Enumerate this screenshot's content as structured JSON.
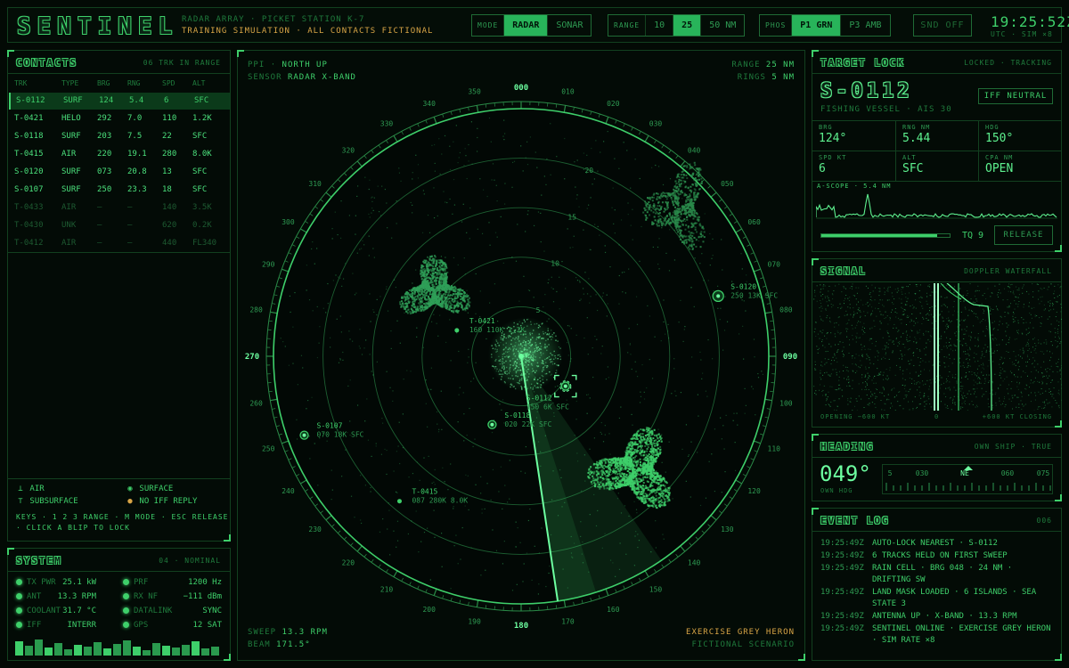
{
  "header": {
    "logo": "SENTINEL",
    "subtitle1": "RADAR ARRAY · PICKET STATION K-7",
    "subtitle2": "TRAINING SIMULATION · ALL CONTACTS FICTIONAL",
    "mode": {
      "label": "MODE",
      "options": [
        "RADAR",
        "SONAR"
      ],
      "selected": "RADAR"
    },
    "range": {
      "label": "RANGE",
      "options": [
        "10",
        "25",
        "50 NM"
      ],
      "selected": "25"
    },
    "phos": {
      "label": "PHOS",
      "options": [
        "P1 GRN",
        "P3 AMB"
      ],
      "selected": "P1 GRN"
    },
    "sound": "SND OFF",
    "clock": "19:25:52Z",
    "clock_sub": "UTC · SIM ×8"
  },
  "contacts": {
    "title": "CONTACTS",
    "count": "06 TRK IN RANGE",
    "columns": [
      "TRK",
      "TYPE",
      "BRG",
      "RNG",
      "SPD",
      "ALT"
    ],
    "rows": [
      {
        "trk": "S-0112",
        "type": "SURF",
        "brg": "124",
        "rng": "5.4",
        "spd": "6",
        "alt": "SFC",
        "state": "sel"
      },
      {
        "trk": "T-0421",
        "type": "HELO",
        "brg": "292",
        "rng": "7.0",
        "spd": "110",
        "alt": "1.2K",
        "state": "live"
      },
      {
        "trk": "S-0118",
        "type": "SURF",
        "brg": "203",
        "rng": "7.5",
        "spd": "22",
        "alt": "SFC",
        "state": "live"
      },
      {
        "trk": "T-0415",
        "type": "AIR",
        "brg": "220",
        "rng": "19.1",
        "spd": "280",
        "alt": "8.0K",
        "state": "live"
      },
      {
        "trk": "S-0120",
        "type": "SURF",
        "brg": "073",
        "rng": "20.8",
        "spd": "13",
        "alt": "SFC",
        "state": "live"
      },
      {
        "trk": "S-0107",
        "type": "SURF",
        "brg": "250",
        "rng": "23.3",
        "spd": "18",
        "alt": "SFC",
        "state": "live"
      },
      {
        "trk": "T-0433",
        "type": "AIR",
        "brg": "—",
        "rng": "—",
        "spd": "140",
        "alt": "3.5K",
        "state": "stale"
      },
      {
        "trk": "T-0430",
        "type": "UNK",
        "brg": "—",
        "rng": "—",
        "spd": "620",
        "alt": "0.2K",
        "state": "stale"
      },
      {
        "trk": "T-0412",
        "type": "AIR",
        "brg": "—",
        "rng": "—",
        "spd": "440",
        "alt": "FL340",
        "state": "stale"
      }
    ],
    "legend": {
      "air": "AIR",
      "surface": "SURFACE",
      "subsurface": "SUBSURFACE",
      "noiff": "NO IFF REPLY",
      "keys1": "KEYS · 1 2 3 RANGE · M MODE · ESC RELEASE",
      "keys2": "· CLICK A BLIP TO LOCK"
    }
  },
  "system": {
    "title": "SYSTEM",
    "status": "04 · NOMINAL",
    "left": [
      {
        "label": "TX PWR",
        "value": "25.1 kW"
      },
      {
        "label": "ANT",
        "value": "13.3 RPM"
      },
      {
        "label": "COOLANT",
        "value": "31.7 °C"
      },
      {
        "label": "IFF",
        "value": "INTERR"
      }
    ],
    "right": [
      {
        "label": "PRF",
        "value": "1200 Hz"
      },
      {
        "label": "RX NF",
        "value": "−111 dBm"
      },
      {
        "label": "DATALINK",
        "value": "SYNC"
      },
      {
        "label": "GPS",
        "value": "12 SAT"
      }
    ],
    "bars": [
      0.8,
      0.55,
      0.9,
      0.45,
      0.7,
      0.35,
      0.6,
      0.5,
      0.75,
      0.4,
      0.65,
      0.85,
      0.5,
      0.3,
      0.7,
      0.55,
      0.45,
      0.6,
      0.8,
      0.4,
      0.5
    ]
  },
  "radar": {
    "ppi_label": "PPI",
    "orientation": "NORTH UP",
    "sensor_label": "SENSOR",
    "sensor": "RADAR X-BAND",
    "range_label": "RANGE",
    "range_value": "25 NM",
    "rings_label": "RINGS",
    "rings_value": "5 NM",
    "ring_labels": [
      "5",
      "10",
      "15",
      "20"
    ],
    "bearings": [
      "000",
      "010",
      "020",
      "030",
      "040",
      "050",
      "060",
      "070",
      "080",
      "090",
      "100",
      "110",
      "120",
      "130",
      "140",
      "150",
      "160",
      "170",
      "180",
      "190",
      "200",
      "210",
      "220",
      "230",
      "240",
      "250",
      "260",
      "270",
      "280",
      "290",
      "300",
      "310",
      "320",
      "330",
      "340",
      "350"
    ],
    "sweep_label": "SWEEP",
    "sweep_value": "13.3 RPM",
    "beam_label": "BEAM",
    "beam_value": "171.5°",
    "exercise": "EXERCISE GREY HERON",
    "scenario": "FICTIONAL SCENARIO",
    "beam_deg": 171.5,
    "contacts": [
      {
        "id": "S-0112",
        "brg": 124,
        "rng": 5.4,
        "line2": "150 6K SFC",
        "locked": true
      },
      {
        "id": "T-0421",
        "brg": 292,
        "rng": 7.0,
        "line2": "160 110K 1.2K"
      },
      {
        "id": "S-0118",
        "brg": 203,
        "rng": 7.5,
        "line2": "020 22K SFC"
      },
      {
        "id": "T-0415",
        "brg": 220,
        "rng": 19.1,
        "line2": "087 280K 8.0K"
      },
      {
        "id": "S-0120",
        "brg": 73,
        "rng": 20.8,
        "line2": "250 13K SFC"
      },
      {
        "id": "S-0107",
        "brg": 250,
        "rng": 23.3,
        "line2": "070 18K SFC"
      }
    ]
  },
  "target": {
    "title": "TARGET LOCK",
    "status": "LOCKED · TRACKING",
    "id": "S-0112",
    "desc": "FISHING VESSEL · AIS 30",
    "iff": "IFF NEUTRAL",
    "cells": [
      {
        "label": "BRG",
        "value": "124°"
      },
      {
        "label": "RNG NM",
        "value": "5.44"
      },
      {
        "label": "HDG",
        "value": "150°"
      },
      {
        "label": "SPD KT",
        "value": "6"
      },
      {
        "label": "ALT",
        "value": "SFC"
      },
      {
        "label": "CPA NM",
        "value": "OPEN"
      }
    ],
    "ascope": "A-SCOPE · 5.4 NM",
    "tq": "TQ 9",
    "tq_fill": 0.9,
    "release": "RELEASE"
  },
  "signal": {
    "title": "SIGNAL",
    "mode": "DOPPLER WATERFALL",
    "left": "OPENING −600 KT",
    "center": "0",
    "right": "+600 KT CLOSING"
  },
  "heading": {
    "title": "HEADING",
    "mode": "OWN SHIP · TRUE",
    "value": "049°",
    "label": "OWN HDG",
    "ticks": [
      "5",
      "030",
      "NE",
      "060",
      "075"
    ]
  },
  "events": {
    "title": "EVENT LOG",
    "count": "006",
    "items": [
      {
        "t": "19:25:49Z",
        "m": "AUTO-LOCK NEAREST · S-0112"
      },
      {
        "t": "19:25:49Z",
        "m": "6 TRACKS HELD ON FIRST SWEEP"
      },
      {
        "t": "19:25:49Z",
        "m": "RAIN CELL · BRG 048 · 24 NM · DRIFTING SW"
      },
      {
        "t": "19:25:49Z",
        "m": "LAND MASK LOADED · 6 ISLANDS · SEA STATE 3"
      },
      {
        "t": "19:25:49Z",
        "m": "ANTENNA UP · X-BAND · 13.3 RPM"
      },
      {
        "t": "19:25:49Z",
        "m": "SENTINEL ONLINE · EXERCISE GREY HERON · SIM RATE ×8"
      }
    ]
  },
  "colors": {
    "phosphor": "#3ecf6a",
    "bright": "#6dffa0",
    "dim": "#1f7a3c",
    "amber": "#d8a546",
    "bg": "#030a05"
  }
}
